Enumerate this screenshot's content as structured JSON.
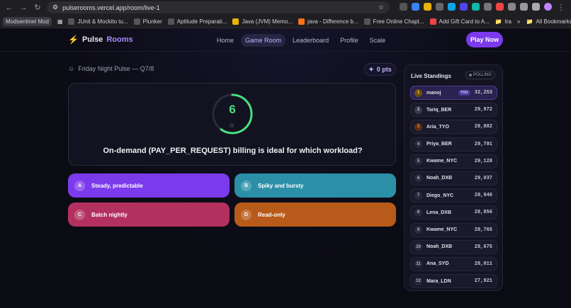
{
  "browser": {
    "url": "pulserooms.vercel.app/room/live-1",
    "bookmarks": [
      "Modsentinel Mod",
      "JUnit & Mockito tu...",
      "Plunker",
      "Aptitude Preparati...",
      "Java (JVM) Memo...",
      "java - Difference b...",
      "Free Online Chapt...",
      "Add Gift Card to A...",
      "Ira"
    ],
    "all_bookmarks": "All Bookmarks"
  },
  "app": {
    "logo_part1": "Pulse",
    "logo_part2": "Rooms",
    "nav": [
      "Home",
      "Game Room",
      "Leaderboard",
      "Profile",
      "Scale"
    ],
    "active_nav": "Game Room",
    "play_now": "Play Now"
  },
  "room": {
    "title": "Friday Night Pulse — Q7/8",
    "points": "0 pts"
  },
  "question": {
    "timer": "6",
    "timer_progress": 0.6,
    "text": "On-demand (PAY_PER_REQUEST) billing is ideal for which workload?",
    "answers": [
      {
        "letter": "A",
        "text": "Steady, predictable",
        "color": "#7c3aed"
      },
      {
        "letter": "B",
        "text": "Spiky and bursty",
        "color": "#2b8fa8"
      },
      {
        "letter": "C",
        "text": "Batch nightly",
        "color": "#b3305f"
      },
      {
        "letter": "D",
        "text": "Read-only",
        "color": "#b85a1a"
      }
    ]
  },
  "standings": {
    "title": "Live Standings",
    "status": "POLLING",
    "you_label": "YOU",
    "rows": [
      {
        "rank": "1",
        "name": "manoj",
        "score": "32,253",
        "you": true
      },
      {
        "rank": "2",
        "name": "Tariq_BER",
        "score": "29,972"
      },
      {
        "rank": "3",
        "name": "Aria_TYO",
        "score": "29,882"
      },
      {
        "rank": "4",
        "name": "Priya_BER",
        "score": "29,791"
      },
      {
        "rank": "5",
        "name": "Kwame_NYC",
        "score": "29,128"
      },
      {
        "rank": "6",
        "name": "Noah_DXB",
        "score": "29,037"
      },
      {
        "rank": "7",
        "name": "Diego_NYC",
        "score": "28,946"
      },
      {
        "rank": "8",
        "name": "Lena_DXB",
        "score": "28,856"
      },
      {
        "rank": "9",
        "name": "Kwame_NYC",
        "score": "28,765"
      },
      {
        "rank": "10",
        "name": "Noah_DXB",
        "score": "28,675"
      },
      {
        "rank": "11",
        "name": "Ana_SYD",
        "score": "28,011"
      },
      {
        "rank": "12",
        "name": "Mara_LDN",
        "score": "27,921"
      }
    ]
  }
}
